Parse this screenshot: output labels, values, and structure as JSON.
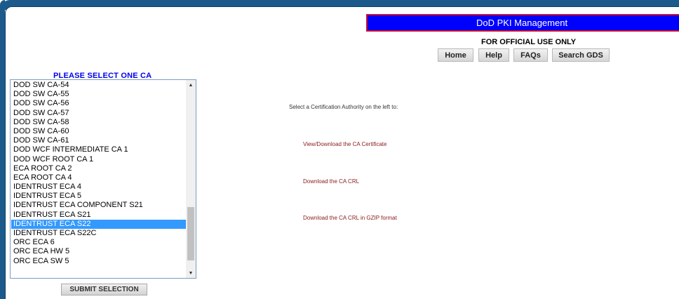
{
  "header": {
    "banner_title": "DoD PKI Management",
    "classification": "FOR OFFICIAL USE ONLY"
  },
  "nav": {
    "home": "Home",
    "help": "Help",
    "faqs": "FAQs",
    "search_gds": "Search GDS"
  },
  "ca_selector": {
    "title": "PLEASE SELECT ONE CA",
    "selected": "IDENTRUST ECA S22",
    "items": [
      "DOD SW CA-54",
      "DOD SW CA-55",
      "DOD SW CA-56",
      "DOD SW CA-57",
      "DOD SW CA-58",
      "DOD SW CA-60",
      "DOD SW CA-61",
      "DOD WCF INTERMEDIATE CA 1",
      "DOD WCF ROOT CA 1",
      "ECA ROOT CA 2",
      "ECA ROOT CA 4",
      "IDENTRUST ECA 4",
      "IDENTRUST ECA 5",
      "IDENTRUST ECA COMPONENT S21",
      "IDENTRUST ECA S21",
      "IDENTRUST ECA S22",
      "IDENTRUST ECA S22C",
      "ORC ECA 6",
      "ORC ECA HW 5",
      "ORC ECA SW 5"
    ],
    "submit_label": "SUBMIT SELECTION"
  },
  "main": {
    "instruction": "Select a Certification Authority on the left to:",
    "actions": [
      "View/Download the CA Certificate",
      "Download the CA CRL",
      "Download the CA CRL in GZIP format"
    ]
  },
  "colors": {
    "frame": "#1d5a8c",
    "banner": "#0000ff",
    "banner_border": "#c8102e",
    "select_title": "#0000ee",
    "selected_item": "#3399ff",
    "action_link": "#8b1a1a"
  }
}
